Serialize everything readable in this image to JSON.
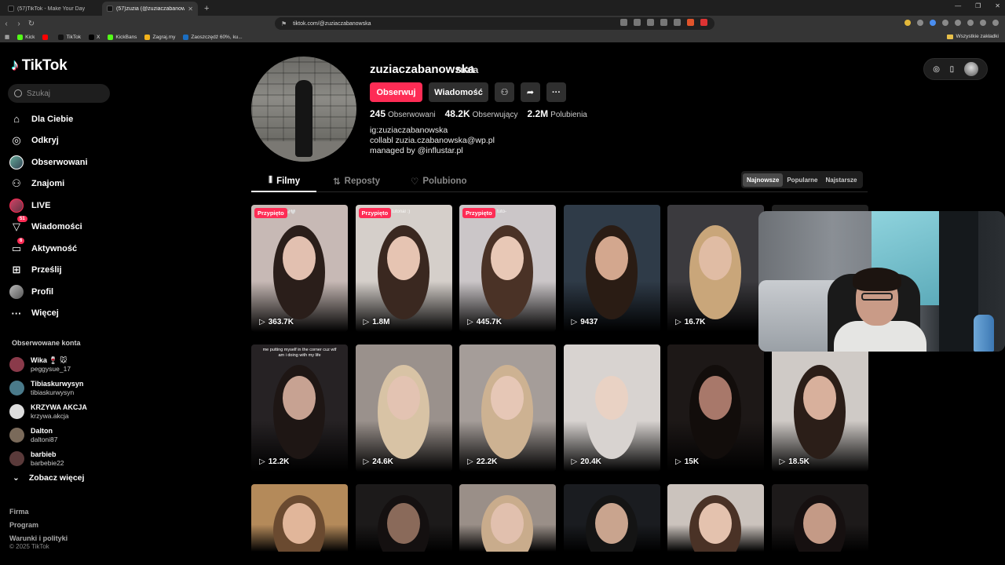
{
  "browser": {
    "tabs": [
      {
        "title": "(57)TikTok - Make Your Day"
      },
      {
        "title": "(57)zuzia (@zuziaczabanowska) |"
      }
    ],
    "new_tab": "+",
    "url": "tiktok.com/@zuziaczabanowska",
    "bookmarks": [
      {
        "label": "Kick",
        "color": "#53fc18"
      },
      {
        "label": "",
        "color": "#ff0000"
      },
      {
        "label": "TikTok",
        "color": "#111111"
      },
      {
        "label": "X",
        "color": "#000000"
      },
      {
        "label": "KickBans",
        "color": "#53fc18"
      },
      {
        "label": "Zagraj.my",
        "color": "#f2b21b"
      },
      {
        "label": "Zaoszczędź 60%, ku...",
        "color": "#1b6ec2"
      }
    ],
    "bookmarks_folder": "Wszystkie zakładki"
  },
  "sidebar": {
    "logo_text": "TikTok",
    "search_placeholder": "Szukaj",
    "nav": [
      {
        "label": "Dla Ciebie",
        "icon": "home-icon"
      },
      {
        "label": "Odkryj",
        "icon": "compass-icon"
      },
      {
        "label": "Obserwowani",
        "icon": "following-avatar-icon"
      },
      {
        "label": "Znajomi",
        "icon": "friends-icon"
      },
      {
        "label": "LIVE",
        "icon": "live-icon"
      },
      {
        "label": "Wiadomości",
        "icon": "messages-icon",
        "badge": "51"
      },
      {
        "label": "Aktywność",
        "icon": "activity-icon",
        "badge": "6"
      },
      {
        "label": "Prześlij",
        "icon": "upload-icon"
      },
      {
        "label": "Profil",
        "icon": "profile-avatar-icon"
      },
      {
        "label": "Więcej",
        "icon": "more-icon"
      }
    ],
    "following_title": "Obserwowane konta",
    "following_accounts": [
      {
        "name": "Wika 🍷 🐭",
        "handle": "peggysue_17",
        "color": "#8a3a4a"
      },
      {
        "name": "Tibiaskurwysyn",
        "handle": "tibiaskurwysyn",
        "color": "#4a7a8a"
      },
      {
        "name": "KRZYWA AKCJA",
        "handle": "krzywa.akcja",
        "color": "#dddddd"
      },
      {
        "name": "Dalton",
        "handle": "daltoni87",
        "color": "#7a6a5a"
      },
      {
        "name": "barbieb",
        "handle": "barbebie22",
        "color": "#5a3a3a"
      }
    ],
    "see_more": "Zobacz więcej",
    "footer_links": [
      "Firma",
      "Program",
      "Warunki i polityki"
    ],
    "copyright": "© 2025 TikTok"
  },
  "profile": {
    "username": "zuziaczabanowska",
    "nickname": "zuzia",
    "follow_label": "Obserwuj",
    "message_label": "Wiadomość",
    "stats": [
      {
        "value": "245",
        "label": "Obserwowani"
      },
      {
        "value": "48.2K",
        "label": "Obserwujący"
      },
      {
        "value": "2.2M",
        "label": "Polubienia"
      }
    ],
    "bio": [
      "ig:zuziaczabanowska",
      "collabl zuzia.czabanowska@wp.pl",
      "managed by @influstar.pl"
    ]
  },
  "tabs": [
    {
      "label": "Filmy",
      "icon": "grid-icon"
    },
    {
      "label": "Reposty",
      "icon": "repost-icon"
    },
    {
      "label": "Polubiono",
      "icon": "heart-outline-icon"
    }
  ],
  "sort": [
    "Najnowsze",
    "Popularne",
    "Najstarsze"
  ],
  "pinned_label": "Przypięto",
  "videos": [
    {
      "views": "363.7K",
      "pinned": true,
      "bg": "#c7b9b5",
      "skin": "#e2c0b0",
      "hair": "#2a1e1a",
      "cap": "GRWM🤍"
    },
    {
      "views": "1.8M",
      "pinned": true,
      "bg": "#d5cfca",
      "skin": "#e6c4b2",
      "hair": "#3a2820",
      "cap": "ke up tutorial :)"
    },
    {
      "views": "445.7K",
      "pinned": true,
      "bg": "#cbc6c8",
      "skin": "#e8c8b6",
      "hair": "#4a3226",
      "cap": "akeup tuto-"
    },
    {
      "views": "9437",
      "pinned": false,
      "bg": "#2f3b48",
      "skin": "#d3a78e",
      "hair": "#2a1c14",
      "cap": ""
    },
    {
      "views": "16.7K",
      "pinned": false,
      "bg": "#3b3a3e",
      "skin": "#e0bca4",
      "hair": "#c9a67a",
      "cap": ""
    },
    {
      "views": "",
      "pinned": false,
      "bg": "#202020",
      "skin": "#202020",
      "hair": "#202020",
      "cap": ""
    },
    {
      "views": "12.2K",
      "pinned": false,
      "bg": "#262224",
      "skin": "#c7a292",
      "hair": "#1e1614",
      "cap": "me putting myself in the corner cuz wtf am i doing with my life"
    },
    {
      "views": "24.6K",
      "pinned": false,
      "bg": "#9a918c",
      "skin": "#e3c3b2",
      "hair": "#d8c3a5",
      "cap": ""
    },
    {
      "views": "22.2K",
      "pinned": false,
      "bg": "#a59d99",
      "skin": "#e6c7b6",
      "hair": "#cdb292",
      "cap": ""
    },
    {
      "views": "20.4K",
      "pinned": false,
      "bg": "#d8d3d0",
      "skin": "#e9d2c4",
      "hair": "#d8d3d0",
      "cap": ""
    },
    {
      "views": "15K",
      "pinned": false,
      "bg": "#1d1817",
      "skin": "#a8786a",
      "hair": "#120d0b",
      "cap": ""
    },
    {
      "views": "18.5K",
      "pinned": false,
      "bg": "#cfcac6",
      "skin": "#d8b09c",
      "hair": "#2b1e18",
      "cap": ""
    },
    {
      "views": "",
      "pinned": false,
      "bg": "#b48a5a",
      "skin": "#e1b69a",
      "hair": "#6a4a30",
      "cap": ""
    },
    {
      "views": "",
      "pinned": false,
      "bg": "#1c1a1a",
      "skin": "#8a6a5a",
      "hair": "#141010",
      "cap": ""
    },
    {
      "views": "",
      "pinned": false,
      "bg": "#9a8f88",
      "skin": "#e1c0ae",
      "hair": "#c9ac8c",
      "cap": ""
    },
    {
      "views": "",
      "pinned": false,
      "bg": "#1a1c20",
      "skin": "#c9a48e",
      "hair": "#141414",
      "cap": ""
    },
    {
      "views": "",
      "pinned": false,
      "bg": "#cbc3bd",
      "skin": "#e4c2ae",
      "hair": "#4a3226",
      "cap": ""
    },
    {
      "views": "",
      "pinned": false,
      "bg": "#1d1a1a",
      "skin": "#c49a86",
      "hair": "#161010",
      "cap": ""
    }
  ],
  "colors": {
    "accent": "#fe2c55",
    "background": "#000000",
    "surface": "#2f2f2f"
  }
}
